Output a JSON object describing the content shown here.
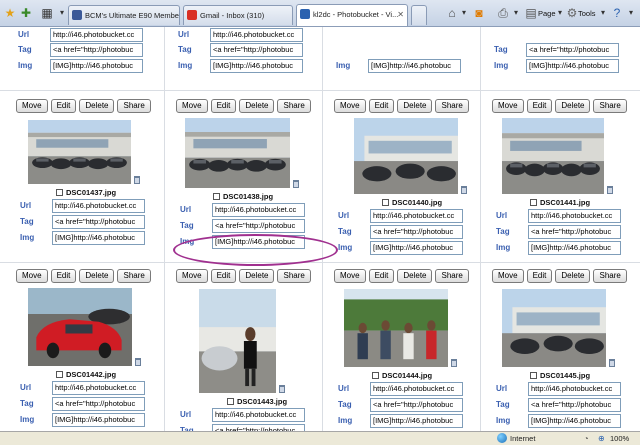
{
  "browser": {
    "tabs": [
      {
        "label": "BCM's Ultimate E90 Member ...",
        "active": false,
        "favicon_color": "#3b5998"
      },
      {
        "label": "Gmail - Inbox (310)",
        "active": false,
        "favicon_color": "#d93025"
      },
      {
        "label": "kl2dc - Photobucket - Vi...",
        "active": true,
        "favicon_color": "#2b62b0"
      }
    ],
    "commands": {
      "page": "Page",
      "tools": "Tools"
    },
    "zoom": "100%",
    "zone": "Internet"
  },
  "photo_actions": {
    "move": "Move",
    "edit": "Edit",
    "delete": "Delete",
    "share": "Share"
  },
  "field_labels": {
    "url": "Url",
    "tag": "Tag",
    "img": "Img"
  },
  "field_values": {
    "url": "http://i46.photobucket.cc",
    "tag": "<a href=\"http://photobuc",
    "img": "[IMG]http://i46.photobuc"
  },
  "top_partial": [
    {
      "rows": [
        "url",
        "tag",
        "img"
      ]
    },
    {
      "rows": [
        "url",
        "tag",
        "img"
      ]
    },
    {
      "rows": [
        "img"
      ]
    },
    {
      "rows": [
        "tag",
        "img"
      ]
    }
  ],
  "photos_row1": [
    {
      "filename": "DSC01437.jpg"
    },
    {
      "filename": "DSC01438.jpg"
    },
    {
      "filename": "DSC01440.jpg"
    },
    {
      "filename": "DSC01441.jpg"
    }
  ],
  "photos_row2": [
    {
      "filename": "DSC01442.jpg"
    },
    {
      "filename": "DSC01443.jpg"
    },
    {
      "filename": "DSC01444.jpg"
    },
    {
      "filename": "DSC01445.jpg"
    }
  ],
  "colors": {
    "label_blue": "#3a5fb0",
    "annotation": "#a0308f"
  }
}
